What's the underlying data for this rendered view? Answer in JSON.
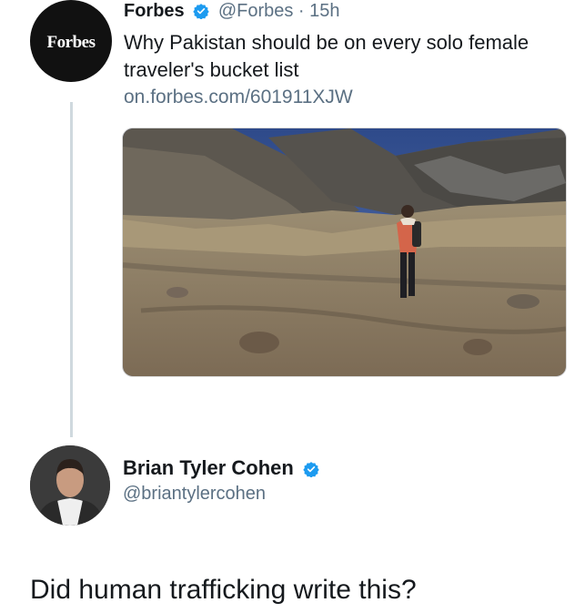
{
  "tweet": {
    "author_name": "Forbes",
    "handle_time": "@Forbes · 15h",
    "avatar_text": "Forbes",
    "text": "Why Pakistan should be on every solo female traveler's bucket list",
    "link": "on.forbes.com/601911XJW"
  },
  "reply": {
    "author_name": "Brian Tyler Cohen",
    "handle": "@briantylercohen",
    "text": "Did human trafficking write this?"
  },
  "colors": {
    "verified": "#1d9bf0",
    "secondary_text": "#5b7083",
    "thread_line": "#cfd9de"
  }
}
